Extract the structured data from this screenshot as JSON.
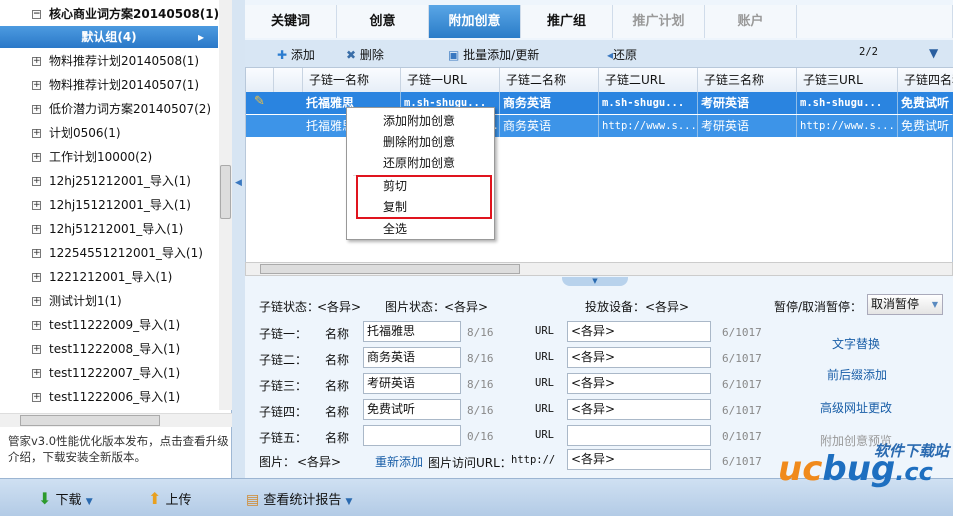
{
  "tree": {
    "root": "核心商业词方案20140508(1)",
    "selected": "默认组(4)",
    "items": [
      "物料推荐计划20140508(1)",
      "物料推荐计划20140507(1)",
      "低价潜力词方案20140507(2)",
      "计划0506(1)",
      "工作计划10000(2)",
      "12hj251212001_导入(1)",
      "12hj151212001_导入(1)",
      "12hj51212001_导入(1)",
      "12254551212001_导入(1)",
      "1221212001_导入(1)",
      "测试计划1(1)",
      "test11222009_导入(1)",
      "test11222008_导入(1)",
      "test11222007_导入(1)",
      "test11222006_导入(1)"
    ]
  },
  "notice": "管家v3.0性能优化版本发布，点击查看升级介绍，下载安装全新版本。",
  "tabs": [
    "关键词",
    "创意",
    "附加创意",
    "推广组",
    "推广计划",
    "账户"
  ],
  "active_tab": "附加创意",
  "toolbar": {
    "add": "添加",
    "delete": "删除",
    "batch": "批量添加/更新",
    "restore": "还原",
    "page": "2/2"
  },
  "grid": {
    "headers": [
      "子链一名称",
      "子链一URL",
      "子链二名称",
      "子链二URL",
      "子链三名称",
      "子链三URL",
      "子链四名称"
    ],
    "rows": [
      [
        "托福雅思",
        "m.sh-shugu...",
        "商务英语",
        "m.sh-shugu...",
        "考研英语",
        "m.sh-shugu...",
        "免费试听"
      ],
      [
        "托福雅思",
        "http://www.s...",
        "商务英语",
        "http://www.s...",
        "考研英语",
        "http://www.s...",
        "免费试听"
      ]
    ]
  },
  "context_menu": [
    "添加附加创意",
    "删除附加创意",
    "还原附加创意",
    "剪切",
    "复制",
    "全选"
  ],
  "form": {
    "link_status_label": "子链状态：",
    "link_status": "<各异>",
    "img_status_label": "图片状态：",
    "img_status": "<各异>",
    "device_label": "投放设备：",
    "device": "<各异>",
    "pause_label": "暂停/取消暂停：",
    "pause_value": "取消暂停",
    "name_label": "名称",
    "url_label": "URL",
    "links": [
      {
        "label": "子链一：",
        "name": "托福雅思",
        "name_count": "8/16",
        "url": "<各异>",
        "url_count": "6/1017"
      },
      {
        "label": "子链二：",
        "name": "商务英语",
        "name_count": "8/16",
        "url": "<各异>",
        "url_count": "6/1017"
      },
      {
        "label": "子链三：",
        "name": "考研英语",
        "name_count": "8/16",
        "url": "<各异>",
        "url_count": "6/1017"
      },
      {
        "label": "子链四：",
        "name": "免费试听",
        "name_count": "8/16",
        "url": "<各异>",
        "url_count": "6/1017"
      },
      {
        "label": "子链五：",
        "name": "",
        "name_count": "0/16",
        "url": "",
        "url_count": "0/1017"
      }
    ],
    "image_label": "图片：",
    "image": "<各异>",
    "re_add": "重新添加",
    "image_url_label": "图片访问URL：",
    "image_url_prefix": "http://",
    "image_url": "<各异>",
    "image_url_count": "6/1017"
  },
  "side_links": [
    "文字替换",
    "前后缀添加",
    "高级网址更改",
    "附加创意预览"
  ],
  "bottom": {
    "download": "下载",
    "upload": "上传",
    "report": "查看统计报告"
  },
  "watermark": "ucbug.cc 软件下载站"
}
